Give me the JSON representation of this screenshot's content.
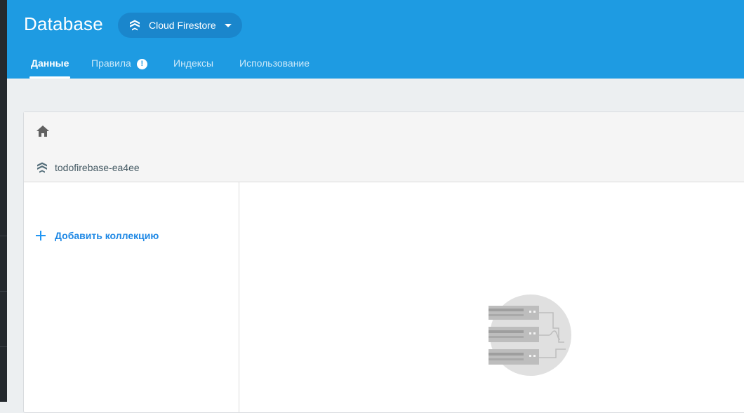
{
  "header": {
    "title": "Database",
    "db_selector": {
      "label": "Cloud Firestore",
      "icon": "firestore-icon"
    },
    "tabs": [
      {
        "label": "Данные",
        "active": true
      },
      {
        "label": "Правила",
        "badge": "!"
      },
      {
        "label": "Индексы"
      },
      {
        "label": "Использование"
      }
    ],
    "accent_color": "#1e9be2"
  },
  "panel": {
    "toolbar": {
      "home_icon": "home-icon"
    },
    "left_column": {
      "project": "todofirebase-ea4ee",
      "add_collection_label": "Добавить коллекцию"
    },
    "empty_state": {
      "illustration_icon": "database-servers-illustration"
    }
  }
}
